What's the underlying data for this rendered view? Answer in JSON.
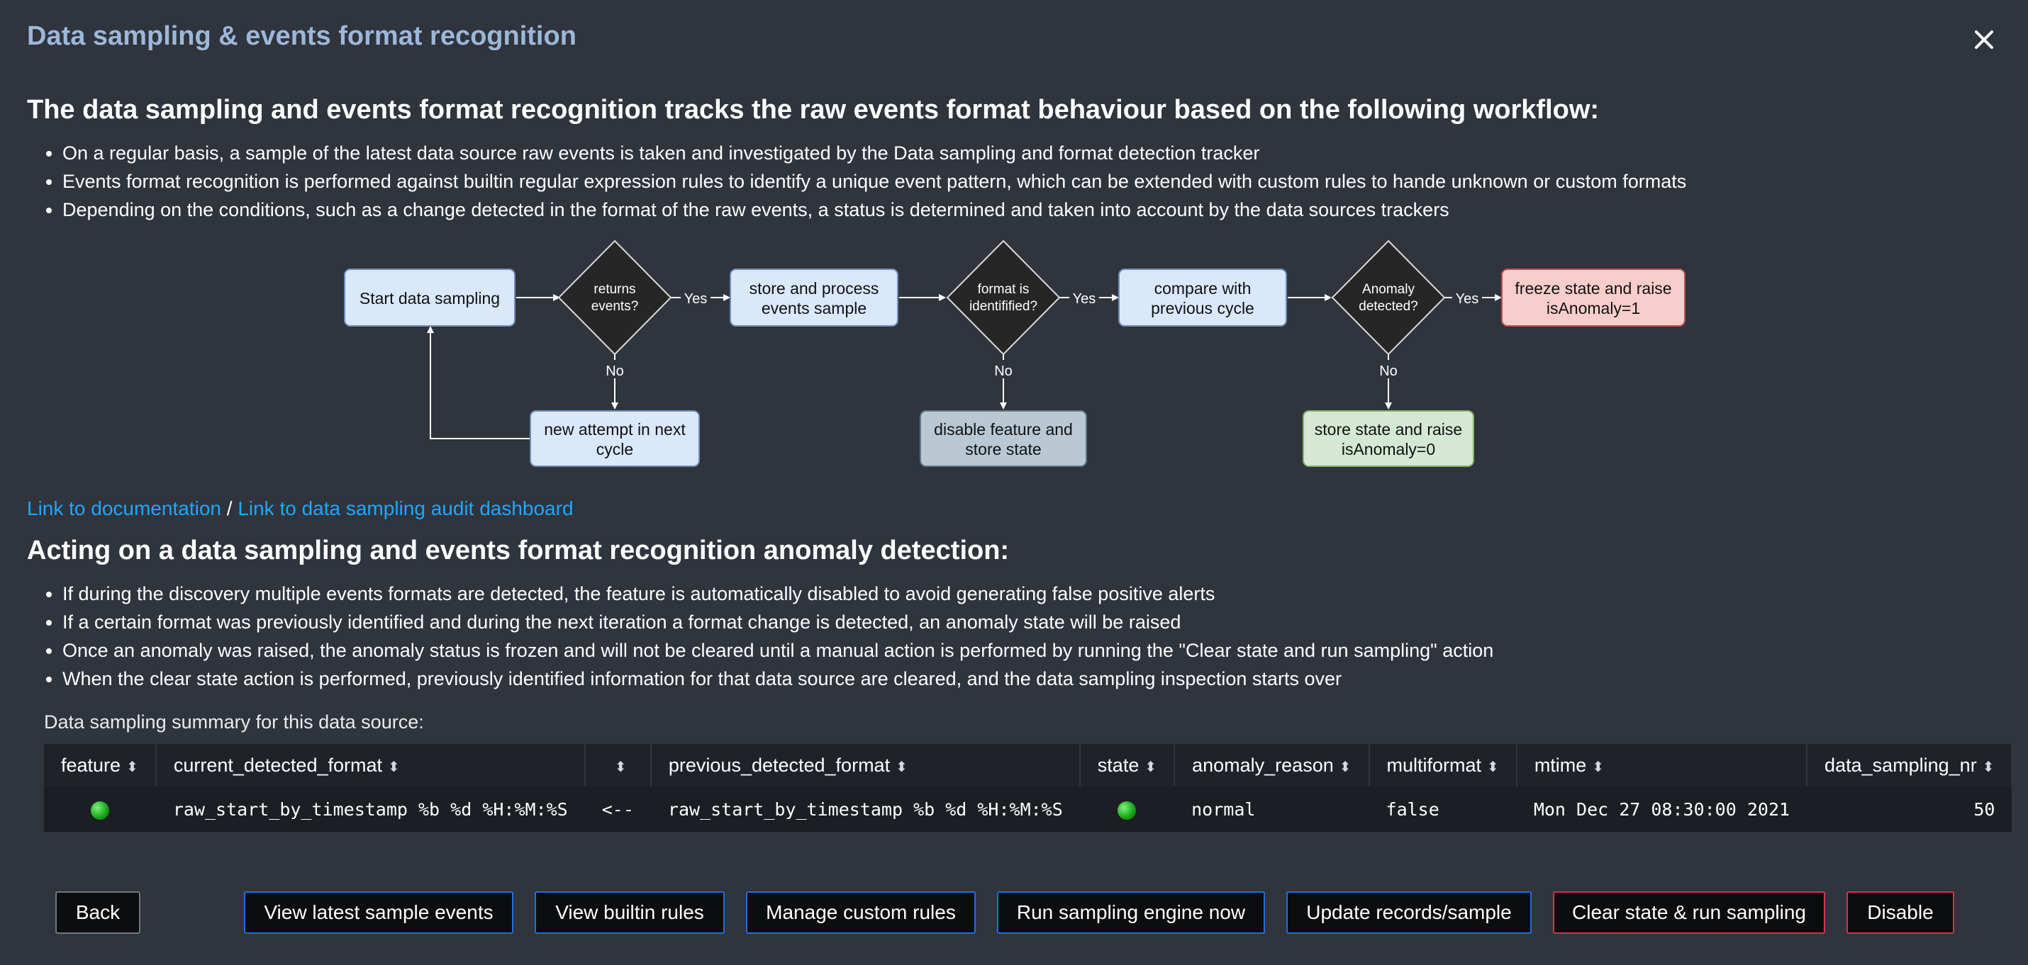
{
  "modal": {
    "title": "Data sampling & events format recognition",
    "close_icon": "close-icon"
  },
  "intro": {
    "heading": "The data sampling and events format recognition tracks the raw events format behaviour based on the following workflow:",
    "bullets": [
      "On a regular basis, a sample of the latest data source raw events is taken and investigated by the Data sampling and format detection tracker",
      "Events format recognition is performed against builtin regular expression rules to identify a unique event pattern, which can be extended with custom rules to hande unknown or custom formats",
      "Depending on the conditions, such as a change detected in the format of the raw events, a status is determined and taken into account by the data sources trackers"
    ]
  },
  "workflow": {
    "start": "Start data sampling",
    "returns": [
      "returns",
      "events?"
    ],
    "yes": "Yes",
    "no": "No",
    "store_process": [
      "store and process",
      "events sample"
    ],
    "new_attempt": [
      "new attempt in next",
      "cycle"
    ],
    "format_identified": [
      "format is",
      "identifified?"
    ],
    "disable": [
      "disable feature and",
      "store state"
    ],
    "compare": [
      "compare with",
      "previous cycle"
    ],
    "anomaly": [
      "Anomaly",
      "detected?"
    ],
    "store_state": [
      "store state and raise",
      "isAnomaly=0"
    ],
    "freeze": [
      "freeze state and raise",
      "isAnomaly=1"
    ]
  },
  "links": {
    "documentation": "Link to documentation",
    "separator": " / ",
    "audit_dashboard": "Link to data sampling audit dashboard"
  },
  "acting": {
    "heading": "Acting on a data sampling and events format recognition anomaly detection:",
    "bullets": [
      "If during the discovery multiple events formats are detected, the feature is automatically disabled to avoid generating false positive alerts",
      "If a certain format was previously identified and during the next iteration a format change is detected, an anomaly state will be raised",
      "Once an anomaly was raised, the anomaly status is frozen and will not be cleared until a manual action is performed by running the \"Clear state and run sampling\" action",
      "When the clear state action is performed, previously identified information for that data source are cleared, and the data sampling inspection starts over"
    ]
  },
  "summary": {
    "label": "Data sampling summary for this data source:",
    "columns": [
      "feature",
      "current_detected_format",
      "",
      "previous_detected_format",
      "state",
      "anomaly_reason",
      "multiformat",
      "mtime",
      "data_sampling_nr"
    ],
    "sort_icon": "sort-icon",
    "row": {
      "feature_status": "green",
      "current_detected_format": "raw_start_by_timestamp %b %d %H:%M:%S",
      "arrow": "<--",
      "previous_detected_format": "raw_start_by_timestamp %b %d %H:%M:%S",
      "state_status": "green",
      "anomaly_reason": "normal",
      "multiformat": "false",
      "mtime": "Mon Dec 27 08:30:00 2021",
      "data_sampling_nr": "50"
    }
  },
  "buttons": {
    "back": "Back",
    "view_latest": "View latest sample events",
    "view_builtin": "View builtin rules",
    "manage_custom": "Manage custom rules",
    "run_engine": "Run sampling engine now",
    "update_records": "Update records/sample",
    "clear_state": "Clear state & run sampling",
    "disable": "Disable"
  },
  "colors": {
    "background": "#2f343d",
    "title": "#9db7d9",
    "link": "#1ea7ff",
    "button_border": "#1f6fe0",
    "danger_border": "#d6324a",
    "status_ok": "#17a117"
  }
}
